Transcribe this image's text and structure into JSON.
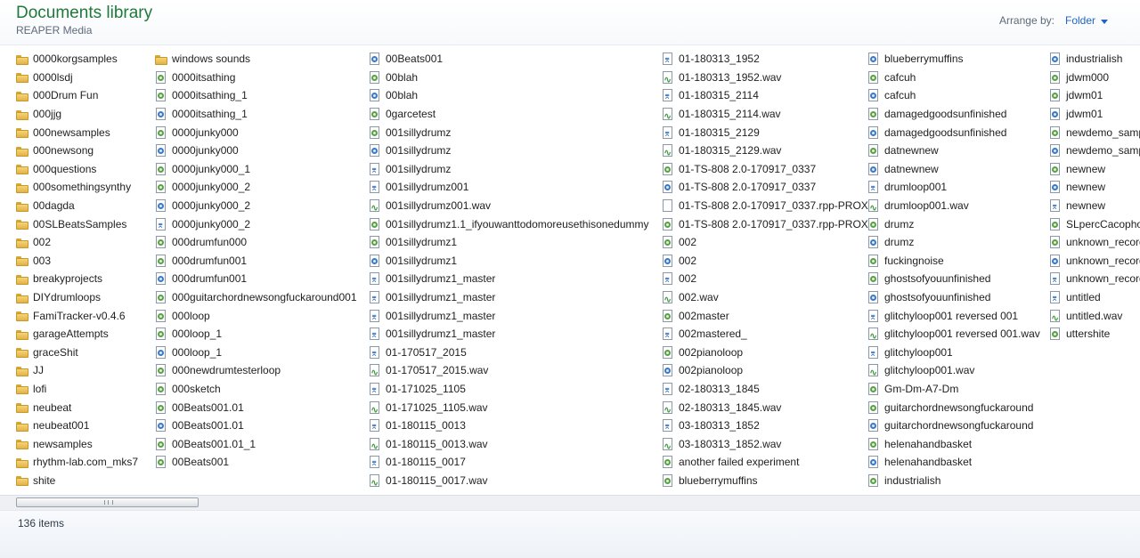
{
  "header": {
    "title": "Documents library",
    "subtitle": "REAPER Media",
    "arrange_label": "Arrange by:",
    "arrange_value": "Folder"
  },
  "columns": [
    {
      "items": [
        {
          "name": "0000korgsamples",
          "icon": "folder"
        },
        {
          "name": "0000lsdj",
          "icon": "folder"
        },
        {
          "name": "000Drum Fun",
          "icon": "folder"
        },
        {
          "name": "000jjg",
          "icon": "folder"
        },
        {
          "name": "000newsamples",
          "icon": "folder"
        },
        {
          "name": "000newsong",
          "icon": "folder"
        },
        {
          "name": "000questions",
          "icon": "folder"
        },
        {
          "name": "000somethingsynthy",
          "icon": "folder"
        },
        {
          "name": "00dagda",
          "icon": "folder"
        },
        {
          "name": "00SLBeatsSamples",
          "icon": "folder"
        },
        {
          "name": "002",
          "icon": "folder"
        },
        {
          "name": "003",
          "icon": "folder"
        },
        {
          "name": "breakyprojects",
          "icon": "folder"
        },
        {
          "name": "DIYdrumloops",
          "icon": "folder"
        },
        {
          "name": "FamiTracker-v0.4.6",
          "icon": "folder"
        },
        {
          "name": "garageAttempts",
          "icon": "folder"
        },
        {
          "name": "graceShit",
          "icon": "folder"
        },
        {
          "name": "JJ",
          "icon": "folder"
        },
        {
          "name": "lofi",
          "icon": "folder"
        },
        {
          "name": "neubeat",
          "icon": "folder"
        },
        {
          "name": "neubeat001",
          "icon": "folder"
        },
        {
          "name": "newsamples",
          "icon": "folder"
        },
        {
          "name": "rhythm-lab.com_mks7",
          "icon": "folder"
        },
        {
          "name": "shite",
          "icon": "folder"
        }
      ]
    },
    {
      "items": [
        {
          "name": "windows sounds",
          "icon": "folder"
        },
        {
          "name": "0000itsathing",
          "icon": "proj"
        },
        {
          "name": "0000itsathing_1",
          "icon": "proj"
        },
        {
          "name": "0000itsathing_1",
          "icon": "bak"
        },
        {
          "name": "0000junky000",
          "icon": "proj"
        },
        {
          "name": "0000junky000",
          "icon": "bak"
        },
        {
          "name": "0000junky000_1",
          "icon": "proj"
        },
        {
          "name": "0000junky000_2",
          "icon": "proj"
        },
        {
          "name": "0000junky000_2",
          "icon": "bak"
        },
        {
          "name": "0000junky000_2",
          "icon": "peak"
        },
        {
          "name": "000drumfun000",
          "icon": "proj"
        },
        {
          "name": "000drumfun001",
          "icon": "proj"
        },
        {
          "name": "000drumfun001",
          "icon": "bak"
        },
        {
          "name": "000guitarchordnewsongfuckaround001",
          "icon": "proj"
        },
        {
          "name": "000loop",
          "icon": "proj"
        },
        {
          "name": "000loop_1",
          "icon": "proj"
        },
        {
          "name": "000loop_1",
          "icon": "bak"
        },
        {
          "name": "000newdrumtesterloop",
          "icon": "proj"
        },
        {
          "name": "000sketch",
          "icon": "proj"
        },
        {
          "name": "00Beats001.01",
          "icon": "proj"
        },
        {
          "name": "00Beats001.01",
          "icon": "bak"
        },
        {
          "name": "00Beats001.01_1",
          "icon": "proj"
        },
        {
          "name": "00Beats001",
          "icon": "proj"
        }
      ]
    },
    {
      "items": [
        {
          "name": "00Beats001",
          "icon": "bak"
        },
        {
          "name": "00blah",
          "icon": "proj"
        },
        {
          "name": "00blah",
          "icon": "bak"
        },
        {
          "name": "0garcetest",
          "icon": "proj"
        },
        {
          "name": "001sillydrumz",
          "icon": "proj"
        },
        {
          "name": "001sillydrumz",
          "icon": "bak"
        },
        {
          "name": "001sillydrumz",
          "icon": "peak"
        },
        {
          "name": "001sillydrumz001",
          "icon": "peak"
        },
        {
          "name": "001sillydrumz001.wav",
          "icon": "wav"
        },
        {
          "name": "001sillydrumz1.1_ifyouwanttodomoreusethisonedummy",
          "icon": "proj"
        },
        {
          "name": "001sillydrumz1",
          "icon": "proj"
        },
        {
          "name": "001sillydrumz1",
          "icon": "bak"
        },
        {
          "name": "001sillydrumz1_master",
          "icon": "peak"
        },
        {
          "name": "001sillydrumz1_master",
          "icon": "peak"
        },
        {
          "name": "001sillydrumz1_master",
          "icon": "peak"
        },
        {
          "name": "001sillydrumz1_master",
          "icon": "peak"
        },
        {
          "name": "01-170517_2015",
          "icon": "peak"
        },
        {
          "name": "01-170517_2015.wav",
          "icon": "wav"
        },
        {
          "name": "01-171025_1105",
          "icon": "peak"
        },
        {
          "name": "01-171025_1105.wav",
          "icon": "wav"
        },
        {
          "name": "01-180115_0013",
          "icon": "peak"
        },
        {
          "name": "01-180115_0013.wav",
          "icon": "wav"
        },
        {
          "name": "01-180115_0017",
          "icon": "peak"
        },
        {
          "name": "01-180115_0017.wav",
          "icon": "wav"
        }
      ]
    },
    {
      "items": [
        {
          "name": "01-180313_1952",
          "icon": "peak"
        },
        {
          "name": "01-180313_1952.wav",
          "icon": "wav"
        },
        {
          "name": "01-180315_2114",
          "icon": "peak"
        },
        {
          "name": "01-180315_2114.wav",
          "icon": "wav"
        },
        {
          "name": "01-180315_2129",
          "icon": "peak"
        },
        {
          "name": "01-180315_2129.wav",
          "icon": "wav"
        },
        {
          "name": "01-TS-808 2.0-170917_0337",
          "icon": "proj"
        },
        {
          "name": "01-TS-808 2.0-170917_0337",
          "icon": "bak"
        },
        {
          "name": "01-TS-808 2.0-170917_0337.rpp-PROX",
          "icon": "blank"
        },
        {
          "name": "01-TS-808 2.0-170917_0337.rpp-PROX",
          "icon": "proj"
        },
        {
          "name": "002",
          "icon": "proj"
        },
        {
          "name": "002",
          "icon": "bak"
        },
        {
          "name": "002",
          "icon": "peak"
        },
        {
          "name": "002.wav",
          "icon": "wav"
        },
        {
          "name": "002master",
          "icon": "proj"
        },
        {
          "name": "002mastered_",
          "icon": "peak"
        },
        {
          "name": "002pianoloop",
          "icon": "proj"
        },
        {
          "name": "002pianoloop",
          "icon": "bak"
        },
        {
          "name": "02-180313_1845",
          "icon": "peak"
        },
        {
          "name": "02-180313_1845.wav",
          "icon": "wav"
        },
        {
          "name": "03-180313_1852",
          "icon": "peak"
        },
        {
          "name": "03-180313_1852.wav",
          "icon": "wav"
        },
        {
          "name": "another failed experiment",
          "icon": "proj"
        },
        {
          "name": "blueberrymuffins",
          "icon": "proj"
        }
      ]
    },
    {
      "items": [
        {
          "name": "blueberrymuffins",
          "icon": "bak"
        },
        {
          "name": "cafcuh",
          "icon": "proj"
        },
        {
          "name": "cafcuh",
          "icon": "bak"
        },
        {
          "name": "damagedgoodsunfinished",
          "icon": "proj"
        },
        {
          "name": "damagedgoodsunfinished",
          "icon": "bak"
        },
        {
          "name": "datnewnew",
          "icon": "proj"
        },
        {
          "name": "datnewnew",
          "icon": "bak"
        },
        {
          "name": "drumloop001",
          "icon": "peak"
        },
        {
          "name": "drumloop001.wav",
          "icon": "wav"
        },
        {
          "name": "drumz",
          "icon": "proj"
        },
        {
          "name": "drumz",
          "icon": "bak"
        },
        {
          "name": "fuckingnoise",
          "icon": "proj"
        },
        {
          "name": "ghostsofyouunfinished",
          "icon": "proj"
        },
        {
          "name": "ghostsofyouunfinished",
          "icon": "bak"
        },
        {
          "name": "glitchyloop001 reversed 001",
          "icon": "peak"
        },
        {
          "name": "glitchyloop001 reversed 001.wav",
          "icon": "wav"
        },
        {
          "name": "glitchyloop001",
          "icon": "peak"
        },
        {
          "name": "glitchyloop001.wav",
          "icon": "wav"
        },
        {
          "name": "Gm-Dm-A7-Dm",
          "icon": "proj"
        },
        {
          "name": "guitarchordnewsongfuckaround",
          "icon": "proj"
        },
        {
          "name": "guitarchordnewsongfuckaround",
          "icon": "bak"
        },
        {
          "name": "helenahandbasket",
          "icon": "proj"
        },
        {
          "name": "helenahandbasket",
          "icon": "bak"
        },
        {
          "name": "industrialish",
          "icon": "proj"
        }
      ]
    },
    {
      "items": [
        {
          "name": "industrialish",
          "icon": "bak"
        },
        {
          "name": "jdwm000",
          "icon": "proj"
        },
        {
          "name": "jdwm01",
          "icon": "proj"
        },
        {
          "name": "jdwm01",
          "icon": "bak"
        },
        {
          "name": "newdemo_samp",
          "icon": "proj"
        },
        {
          "name": "newdemo_samp",
          "icon": "bak"
        },
        {
          "name": "newnew",
          "icon": "proj"
        },
        {
          "name": "newnew",
          "icon": "bak"
        },
        {
          "name": "newnew",
          "icon": "peak"
        },
        {
          "name": "SLpercCacophor",
          "icon": "proj"
        },
        {
          "name": "unknown_record",
          "icon": "proj"
        },
        {
          "name": "unknown_record",
          "icon": "bak"
        },
        {
          "name": "unknown_record",
          "icon": "peak"
        },
        {
          "name": "untitled",
          "icon": "peak"
        },
        {
          "name": "untitled.wav",
          "icon": "wav"
        },
        {
          "name": "uttershite",
          "icon": "proj"
        }
      ]
    }
  ],
  "status": {
    "count_text": "136 items"
  }
}
